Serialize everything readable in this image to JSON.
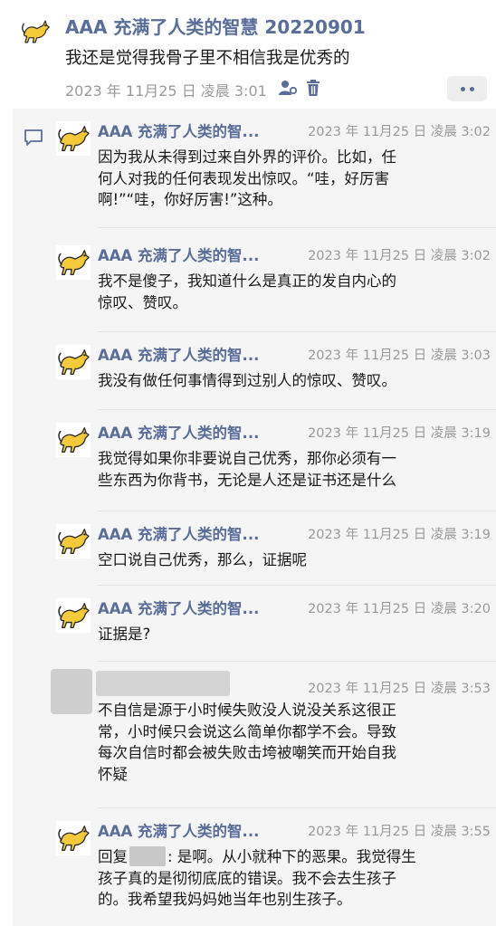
{
  "post": {
    "author": "AAA 充满了人类的智慧 20220901",
    "text": "我还是觉得我骨子里不相信我是优秀的",
    "time": "2023 年 11月25 日 凌晨 3:01",
    "icons": [
      "user-settings-icon",
      "trash-icon",
      "more-icon"
    ]
  },
  "comments": [
    {
      "author": "AAA 充满了人类的智...",
      "time": "2023 年 11月25 日 凌晨 3:02",
      "lines": [
        "因为我从未得到过来自外界的评价。比如，任",
        "何人对我的任何表现发出惊叹。“哇，好厉害",
        "啊!”“哇，你好厉害!”这种。"
      ]
    },
    {
      "author": "AAA 充满了人类的智...",
      "time": "2023 年 11月25 日 凌晨 3:02",
      "lines": [
        "我不是傻子，我知道什么是真正的发自内心的",
        "惊叹、赞叹。"
      ]
    },
    {
      "author": "AAA 充满了人类的智...",
      "time": "2023 年 11月25 日 凌晨 3:03",
      "lines": [
        "我没有做任何事情得到过别人的惊叹、赞叹。"
      ]
    },
    {
      "author": "AAA 充满了人类的智...",
      "time": "2023 年 11月25 日 凌晨 3:19",
      "lines": [
        "我觉得如果你非要说自己优秀，那你必须有一",
        "些东西为你背书，无论是人还是证书还是什么"
      ]
    },
    {
      "author": "AAA 充满了人类的智...",
      "time": "2023 年 11月25 日 凌晨 3:19",
      "lines": [
        "空口说自己优秀，那么，证据呢"
      ]
    },
    {
      "author": "AAA 充满了人类的智...",
      "time": "2023 年 11月25 日 凌晨 3:20",
      "lines": [
        "证据是?"
      ]
    },
    {
      "author": "",
      "time": "2023 年 11月25 日 凌晨 3:53",
      "lines": [
        "不自信是源于小时候失败没人说没关系这很正",
        "常，小时候只会说这么简单你都学不会。导致",
        "每次自信时都会被失败击垮被嘲笑而开始自我",
        "怀疑"
      ]
    },
    {
      "author": "AAA 充满了人类的智...",
      "time": "2023 年 11月25 日 凌晨 3:55",
      "reply_prefix": "回复",
      "reply_rest": ": 是啊。从小就种下的恶果。我觉得生",
      "lines": [
        "孩子真的是彻彻底底的错误。我不会去生孩子",
        "的。我希望我妈妈她当年也别生孩子。"
      ]
    }
  ]
}
